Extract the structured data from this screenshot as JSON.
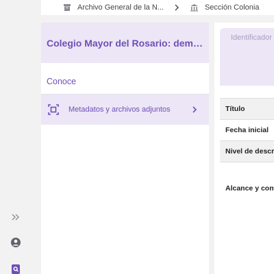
{
  "breadcrumb": {
    "items": [
      {
        "label": "Archivo General de la N...",
        "icon": "archive-icon"
      },
      {
        "label": "Sección Colonia",
        "icon": "building-icon"
      }
    ],
    "separator_icon": "chevron-right-icon"
  },
  "left_panel": {
    "title": "Colegio Mayor del Rosario: deman...",
    "section_label": "Conoce",
    "menu_items": [
      {
        "label": "Metadatos y archivos adjuntos",
        "icon": "metadata-frame-icon"
      }
    ]
  },
  "right_panel": {
    "identifier_placeholder": "Identificador",
    "fields": [
      "Título",
      "Fecha inicial",
      "Nivel de descri",
      "Alcance y conte"
    ]
  },
  "rail": {
    "icons": [
      "expand-double-chevron-icon",
      "user-account-icon",
      "search-document-icon"
    ]
  },
  "colors": {
    "accent": "#6f4fb6",
    "accent_light": "#ece6f6",
    "background": "#f2f2f3"
  }
}
